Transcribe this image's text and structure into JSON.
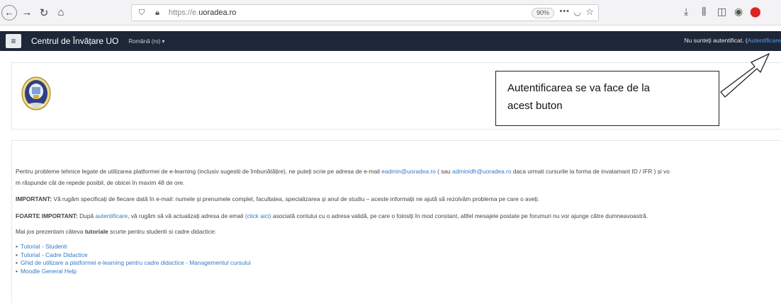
{
  "browser": {
    "url_prefix": "https://e.",
    "url_host": "uoradea.ro",
    "zoom": "90%",
    "back_icon": "arrow-left-icon",
    "forward_icon": "arrow-right-icon"
  },
  "navbar": {
    "brand": "Centrul de Învățare UO",
    "language": "Română (ro) ▾",
    "login_text": "Nu sunteți autentificat. (",
    "login_link": "Autentificare"
  },
  "callout": {
    "line1": "Autentificarea se va face de la",
    "line2": "acest buton"
  },
  "content": {
    "p1_a": "Pentru probleme tehnice legate de utilizarea platformei de e-learning (inclusiv sugestii de îmbunătățire), ne puteți scrie pe adresa de e-mail ",
    "p1_email1": "eadmin@uoradea.ro",
    "p1_b": " ( sau ",
    "p1_email2": "adminidfr@uoradea.ro",
    "p1_c": " daca urmati cursurile la forma de invatamant ID / IFR ) și vo",
    "p1_d": "m răspunde cât de repede posibil, de obicei în maxim 48 de ore.",
    "p2_label": "IMPORTANT:",
    "p2_text": " Vă rugăm specificați de fiecare dată în e-mail: numele și prenumele complet, facultatea, specializarea și anul de studiu – aceste informații ne ajută să rezolvăm problema pe care o aveți.",
    "p3_label": "FOARTE IMPORTANT:",
    "p3_a": " După ",
    "p3_link1": "autentificare",
    "p3_b": ", vă rugăm să vă actualizați adresa de email ",
    "p3_link2": "(click aici)",
    "p3_c": " asociată contului cu o adresa validă, pe care o folosiți în mod constant, altfel mesajele postate pe forumuri nu vor ajunge către dumneavoastră.",
    "p4_a": "Mai jos prezentam câteva ",
    "p4_bold": "tutoriale",
    "p4_b": " scurte pentru studenti si cadre didactice:",
    "tutorials": [
      "Tutorial - Studenti",
      "Tutorial - Cadre Didactice",
      "Ghid de utilizare a platformei e-learning pentru cadre didactice - Managementul cursului",
      "Moodle General Help"
    ]
  }
}
